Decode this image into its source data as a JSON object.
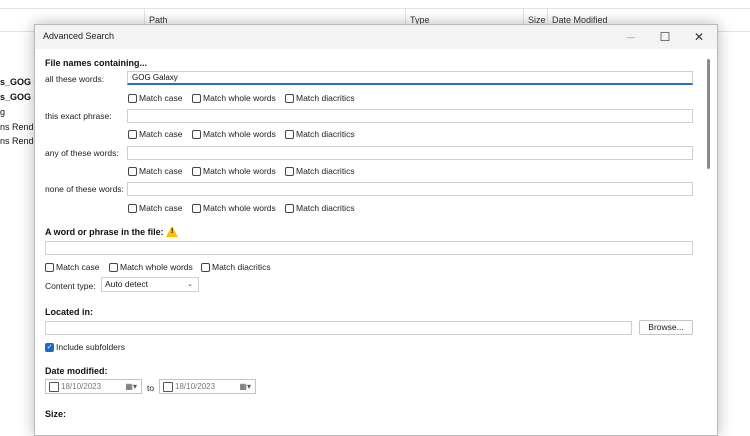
{
  "background": {
    "columns": [
      {
        "label": "Path"
      },
      {
        "label": "Type"
      },
      {
        "label": "Size"
      },
      {
        "label": "Date Modified"
      }
    ],
    "rows": [
      "s_GOG G",
      "s_GOG G",
      "g",
      "ns Render",
      "ns Render"
    ]
  },
  "dialog": {
    "title": "Advanced Search",
    "controls": {
      "minimize": "—",
      "maximize": "☐",
      "close": "✕"
    },
    "filenames": {
      "heading": "File names containing...",
      "rows": [
        {
          "label": "all these words:",
          "value": "GOG Galaxy"
        },
        {
          "label": "this exact phrase:",
          "value": ""
        },
        {
          "label": "any of these words:",
          "value": ""
        },
        {
          "label": "none of these words:",
          "value": ""
        }
      ],
      "options": [
        "Match case",
        "Match whole words",
        "Match diacritics"
      ]
    },
    "infile": {
      "heading": "A word or phrase in the file:",
      "value": "",
      "options": [
        "Match case",
        "Match whole words",
        "Match diacritics"
      ],
      "content_type_label": "Content type:",
      "content_type_value": "Auto detect"
    },
    "location": {
      "heading": "Located in:",
      "value": "",
      "browse_label": "Browse...",
      "include_subfolders_label": "Include subfolders",
      "include_subfolders_checked": true
    },
    "date": {
      "heading": "Date modified:",
      "from": "18/10/2023",
      "to_label": "to",
      "to": "18/10/2023"
    },
    "size": {
      "heading": "Size:"
    }
  }
}
